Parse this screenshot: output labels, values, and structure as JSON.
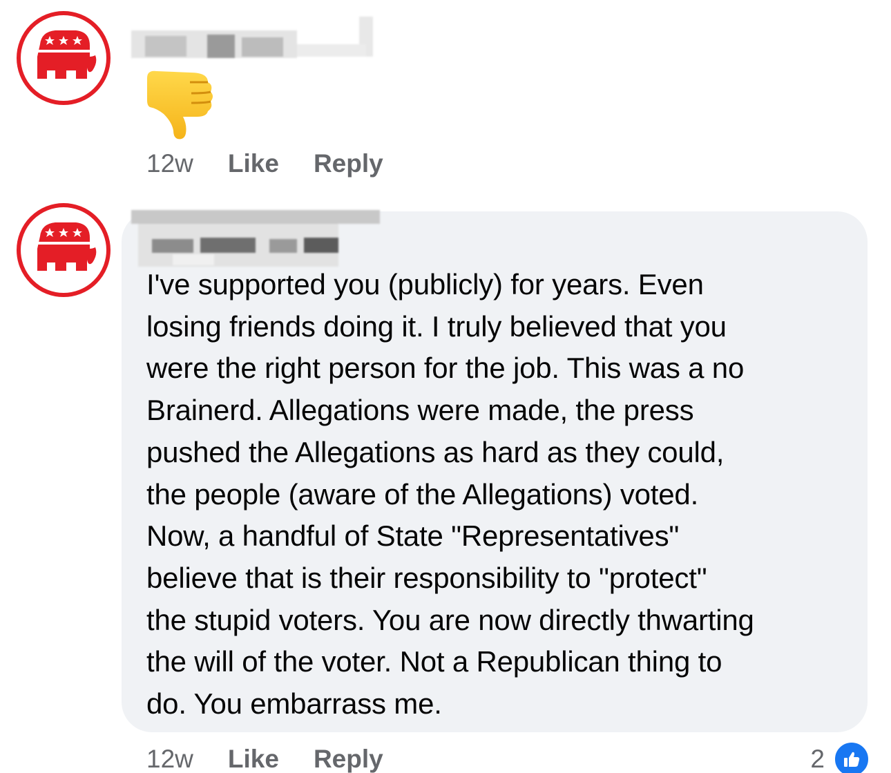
{
  "comments": [
    {
      "author": "",
      "content": "👎",
      "time": "12w",
      "like_label": "Like",
      "reply_label": "Reply",
      "avatar_icon": "gop-elephant-icon"
    },
    {
      "author": "",
      "content": "I've supported you (publicly) for years.  Even\nlosing friends doing it.  I truly believed that you\nwere the right person for the job.  This was a no\nBrainerd.  Allegations were made, the press\npushed the Allegations as hard as they could,\nthe people (aware of the Allegations) voted.\nNow,  a handful of State \"Representatives\"\nbelieve that is their responsibility to \"protect\"\nthe stupid voters.  You are now directly thwarting\nthe will of the voter.  Not a Republican thing to\ndo.  You embarrass me.",
      "time": "12w",
      "like_label": "Like",
      "reply_label": "Reply",
      "reaction_count": "2",
      "avatar_icon": "gop-elephant-icon"
    }
  ],
  "colors": {
    "avatar_ring": "#e41e26",
    "bubble_bg": "#f0f2f5",
    "meta_text": "#65676b",
    "like_blue": "#1877f2"
  }
}
